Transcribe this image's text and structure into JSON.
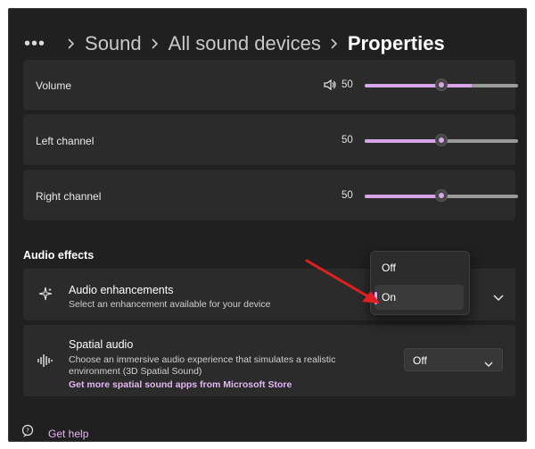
{
  "breadcrumb": {
    "items": [
      "Sound",
      "All sound devices"
    ],
    "current": "Properties"
  },
  "output_settings": {
    "volume": {
      "label": "Volume",
      "value": "50",
      "level": 50
    },
    "left_channel": {
      "label": "Left channel",
      "value": "50",
      "level": 50
    },
    "right_channel": {
      "label": "Right channel",
      "value": "50",
      "level": 50
    }
  },
  "audio_effects": {
    "section_title": "Audio effects",
    "enhancements": {
      "title": "Audio enhancements",
      "description": "Select an enhancement available for your device",
      "options": [
        "Off",
        "On"
      ],
      "selected": "On"
    },
    "spatial_audio": {
      "title": "Spatial audio",
      "description_line1": "Choose an immersive audio experience that simulates a realistic",
      "description_line2": "environment (3D Spatial Sound)",
      "link": "Get more spatial sound apps from Microsoft Store",
      "selected_value": "Off"
    }
  },
  "footer": {
    "help_label": "Get help"
  },
  "colors": {
    "accent": "#d8a4e8",
    "background": "#202020",
    "card": "#2b2b2b",
    "annotation_arrow": "#e02020"
  },
  "icons": [
    "more-icon",
    "chevron-right-icon",
    "speaker-icon",
    "sparkle-icon",
    "spatial-audio-icon",
    "chevron-down-icon",
    "help-icon"
  ]
}
